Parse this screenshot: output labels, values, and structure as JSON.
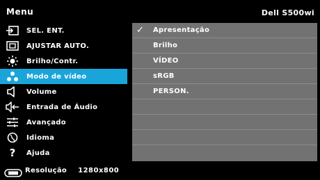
{
  "header": {
    "title": "Menu",
    "model": "Dell S500wi"
  },
  "menu": {
    "items": [
      {
        "label": "SEL. ENT.",
        "icon": "input-source-icon"
      },
      {
        "label": "AJUSTAR AUTO.",
        "icon": "auto-adjust-icon"
      },
      {
        "label": "Brilho/Contr.",
        "icon": "brightness-icon"
      },
      {
        "label": "Modo de vídeo",
        "icon": "video-mode-icon",
        "active": true
      },
      {
        "label": "Volume",
        "icon": "speaker-icon"
      },
      {
        "label": "Entrada de Áudio",
        "icon": "audio-input-icon"
      },
      {
        "label": "Avançado",
        "icon": "advanced-sliders-icon"
      },
      {
        "label": "Idioma",
        "icon": "language-icon"
      },
      {
        "label": "Ajuda",
        "icon": "help-icon"
      }
    ]
  },
  "submenu": {
    "options": [
      {
        "label": "Apresentação",
        "checked": true
      },
      {
        "label": "Brilho"
      },
      {
        "label": "VÍDEO"
      },
      {
        "label": "sRGB"
      },
      {
        "label": "PERSON."
      },
      {
        "label": ""
      },
      {
        "label": ""
      },
      {
        "label": ""
      },
      {
        "label": ""
      }
    ],
    "check_glyph": "✓"
  },
  "footer": {
    "label": "Resolução",
    "value": "1280x800",
    "icon": "resolution-icon"
  },
  "colors": {
    "accent": "#1aa5da",
    "panel": "#727272",
    "background": "#000000"
  }
}
